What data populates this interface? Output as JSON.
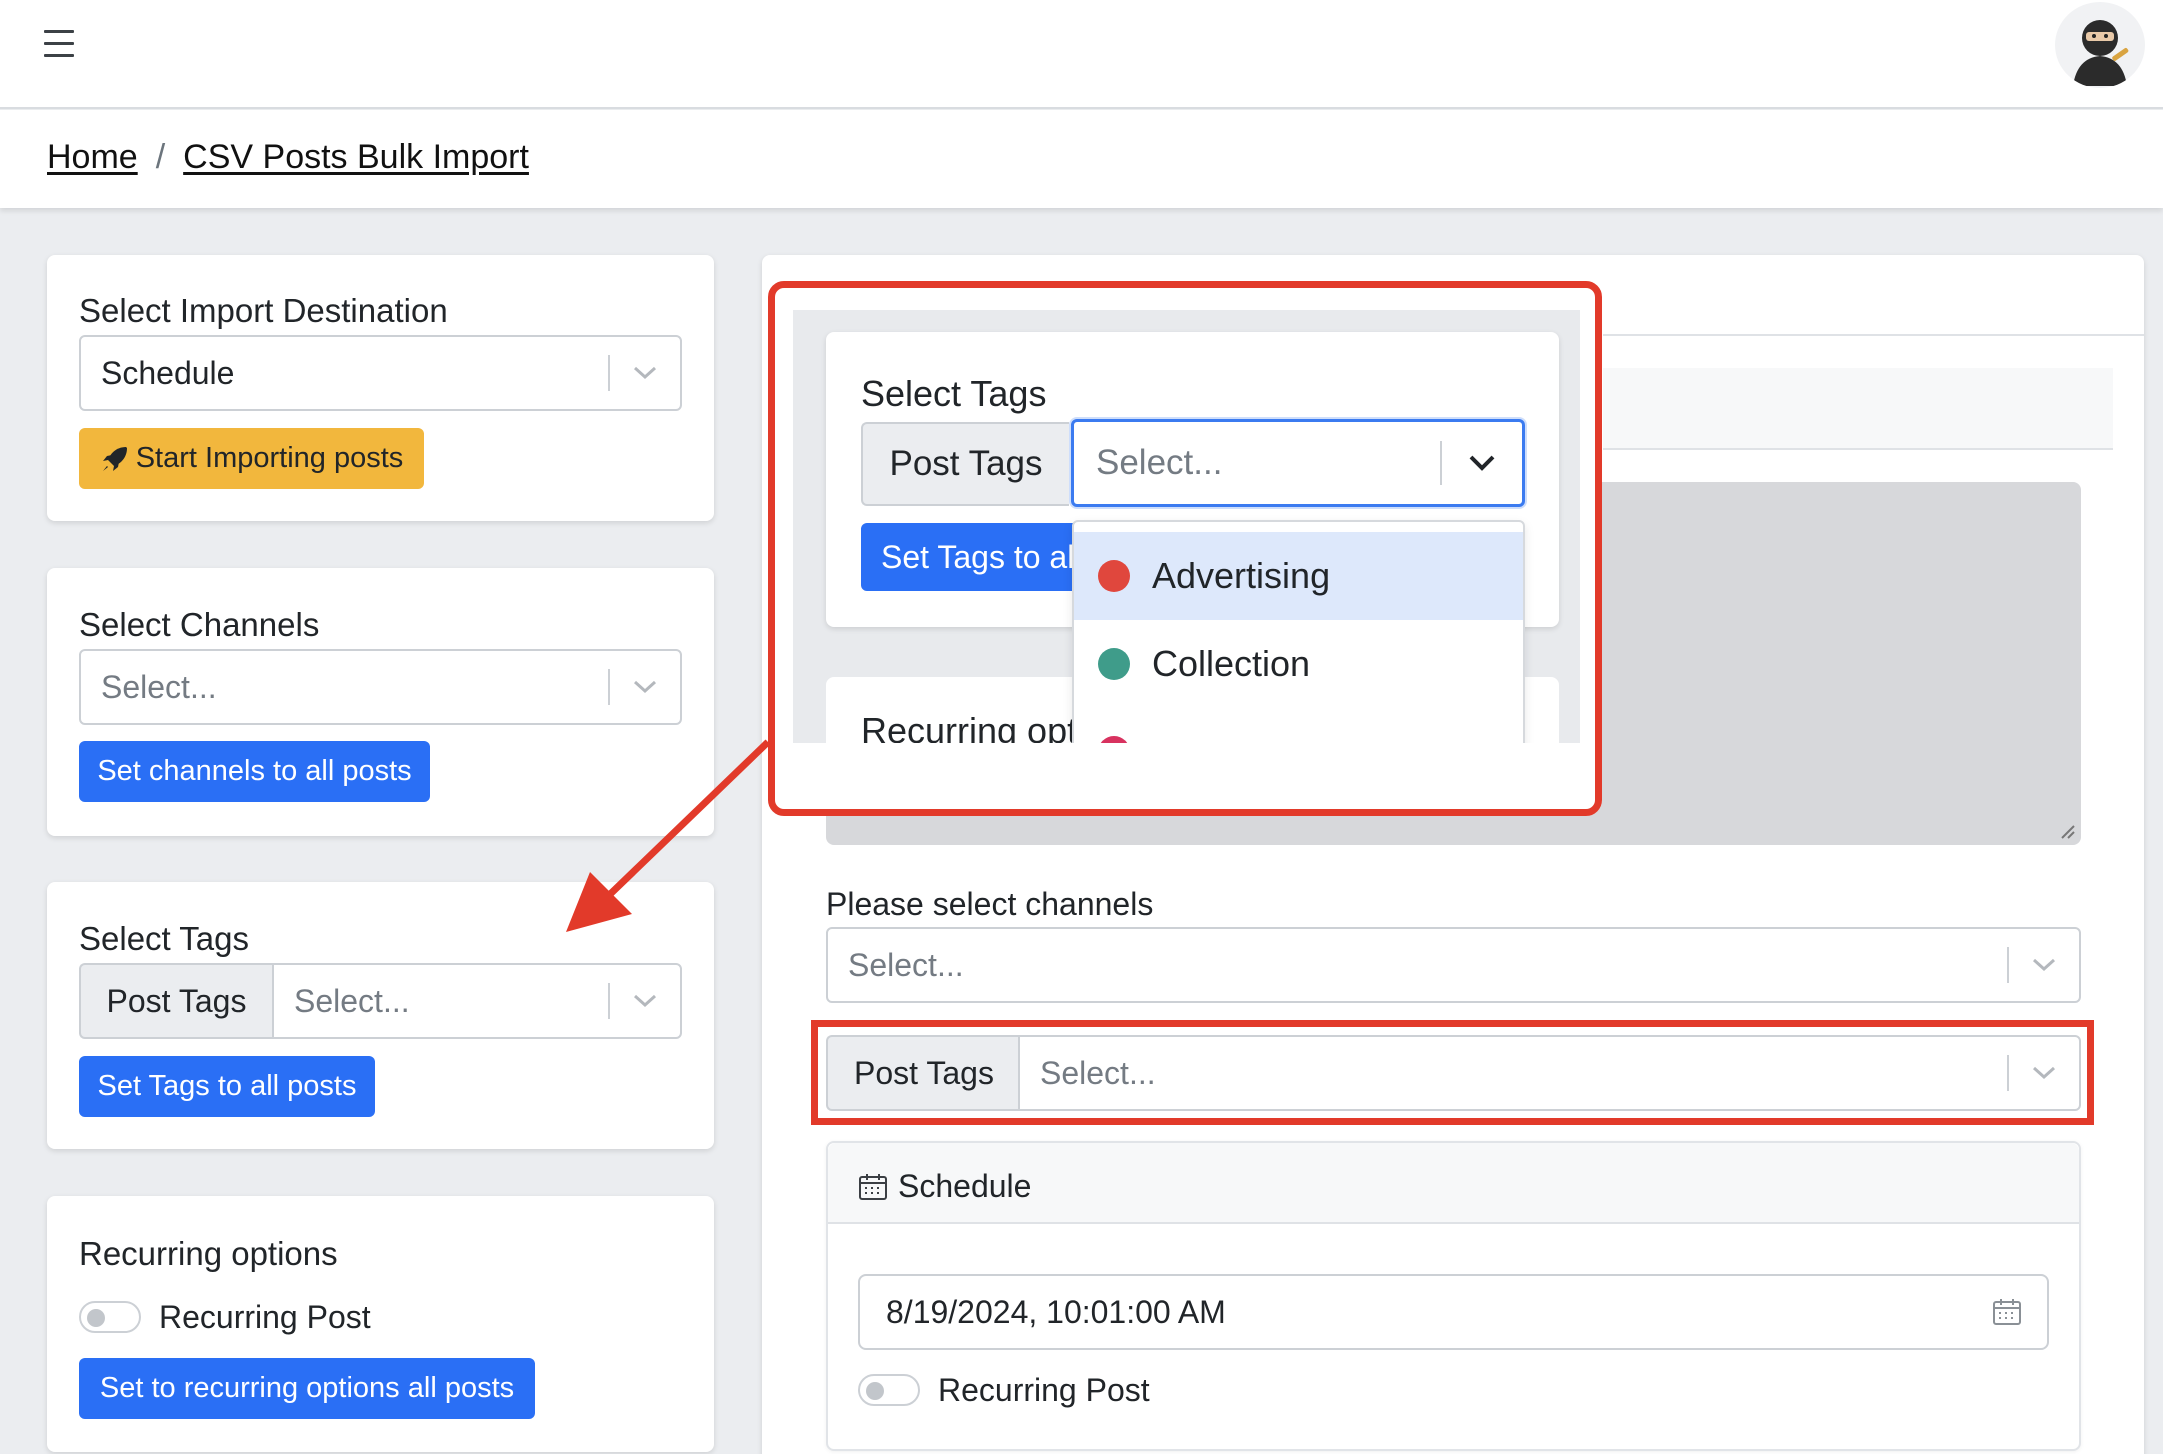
{
  "header": {
    "menu_icon": "hamburger-icon",
    "avatar_icon": "ninja-avatar-icon"
  },
  "breadcrumb": {
    "home": "Home",
    "current": "CSV Posts Bulk Import"
  },
  "left": {
    "destination": {
      "label": "Select Import Destination",
      "value": "Schedule",
      "button": "Start Importing posts"
    },
    "channels": {
      "label": "Select Channels",
      "placeholder": "Select...",
      "button": "Set channels to all posts"
    },
    "tags": {
      "label": "Select Tags",
      "addon": "Post Tags",
      "placeholder": "Select...",
      "button": "Set Tags to all posts"
    },
    "recurring": {
      "label": "Recurring options",
      "toggle_label": "Recurring Post",
      "button": "Set to recurring options all posts"
    }
  },
  "zoom": {
    "label": "Select Tags",
    "addon": "Post Tags",
    "placeholder": "Select...",
    "button_partial": "Set Tags to al",
    "recurring_partial": "Recurring opt",
    "options": [
      {
        "label": "Advertising",
        "color": "#e0473d"
      },
      {
        "label": "Collection",
        "color": "#3f9c8a"
      }
    ],
    "third_option_color": "#d8325f"
  },
  "right": {
    "channels_label": "Please select channels",
    "channels_placeholder": "Select...",
    "tags_addon": "Post Tags",
    "tags_placeholder": "Select...",
    "schedule_title": "Schedule",
    "datetime": "8/19/2024, 10:01:00 AM",
    "recurring_label": "Recurring Post"
  },
  "colors": {
    "annotation_red": "#e23a2a",
    "primary_blue": "#2a6ff5",
    "warning_yellow": "#f2b73d"
  }
}
